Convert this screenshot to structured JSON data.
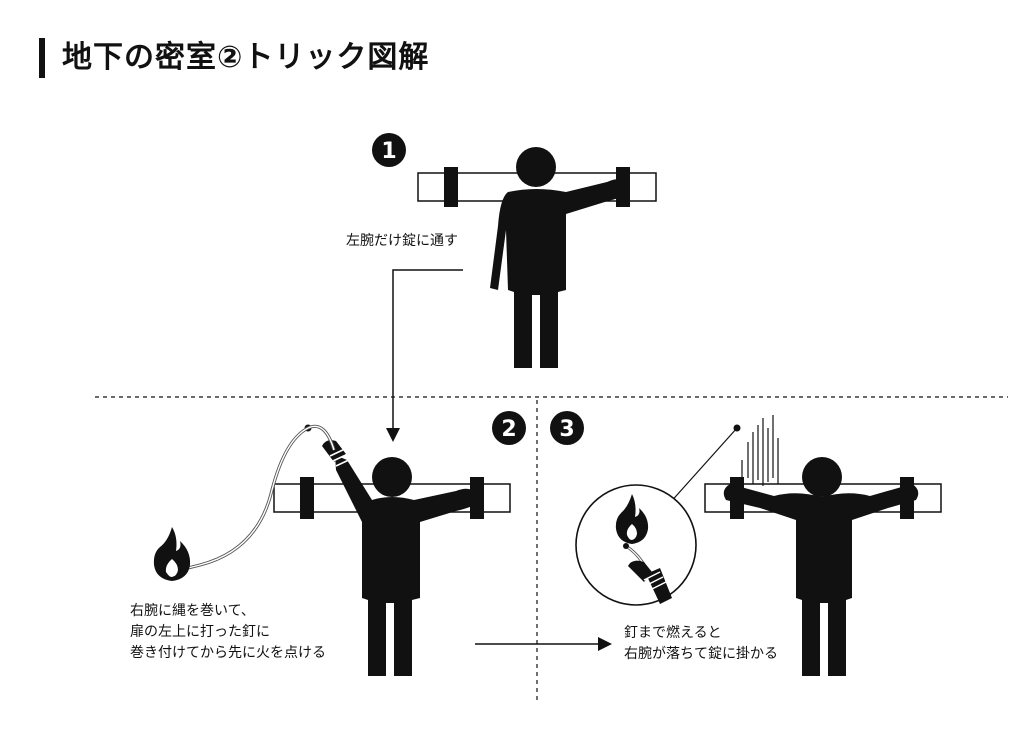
{
  "title": "地下の密室②トリック図解",
  "steps": [
    {
      "number": "1",
      "caption": [
        "左腕だけ錠に通す"
      ]
    },
    {
      "number": "2",
      "caption": [
        "右腕に縄を巻いて、",
        "扉の左上に打った釘に",
        "巻き付けてから先に火を点ける"
      ]
    },
    {
      "number": "3",
      "caption": [
        "釘まで燃えると",
        "右腕が落ちて錠に掛かる"
      ]
    }
  ],
  "colors": {
    "ink": "#111111",
    "background": "#ffffff",
    "rope": "#555555"
  },
  "icons": [
    "flame-icon",
    "nail-icon",
    "falling-lines-icon",
    "arrow-icon"
  ]
}
